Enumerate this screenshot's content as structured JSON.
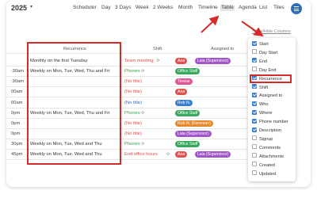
{
  "header": {
    "year": "2025",
    "views": [
      "Scheduler",
      "Day",
      "3 Days",
      "Week",
      "2 Weeks",
      "Month",
      "Timeline",
      "Table",
      "Agenda",
      "List",
      "Tiles"
    ],
    "active_view": "Table",
    "show_hide_columns": "Show/Hide Columns"
  },
  "table": {
    "columns": {
      "recurrence": "Recurrence",
      "shift": "Shift",
      "assigned_to": "Assigned to"
    },
    "rows": [
      {
        "time": "",
        "recurrence": "Monthly on the first Tuesday",
        "shift": "Team meeting",
        "shift_color": "red",
        "assignees": [
          {
            "name": "Ana",
            "color": "red"
          },
          {
            "name": "Laia (Supervisor)",
            "color": "purple"
          }
        ]
      },
      {
        "time": ":30am",
        "recurrence": "Weekly on Mon, Tue, Wed, Thu and Fri",
        "shift": "Phones",
        "shift_color": "green",
        "assignees": [
          {
            "name": "Office Staff",
            "color": "green"
          }
        ]
      },
      {
        "time": ":30am",
        "recurrence": "",
        "shift": "(No title)",
        "shift_color": "red",
        "assignees": [
          {
            "name": "Terese",
            "color": "pink"
          }
        ]
      },
      {
        "time": "00am",
        "recurrence": "",
        "shift": "(No title)",
        "shift_color": "red",
        "assignees": [
          {
            "name": "Ana",
            "color": "red"
          }
        ]
      },
      {
        "time": "00am",
        "recurrence": "",
        "shift": "(No title)",
        "shift_color": "blue",
        "assignees": [
          {
            "name": "Rob N.",
            "color": "blue"
          }
        ]
      },
      {
        "time": "0pm",
        "recurrence": "Weekly on Mon, Tue, Wed, Thu and Fri",
        "shift": "Phones",
        "shift_color": "green",
        "assignees": [
          {
            "name": "Office Staff",
            "color": "green"
          }
        ]
      },
      {
        "time": "0pm",
        "recurrence": "",
        "shift": "(No title)",
        "shift_color": "red",
        "assignees": [
          {
            "name": "Rob N. (Foreman)",
            "color": "orange"
          }
        ]
      },
      {
        "time": "0pm",
        "recurrence": "",
        "shift": "(No title)",
        "shift_color": "red",
        "assignees": [
          {
            "name": "Laia (Supervisor)",
            "color": "purple"
          }
        ]
      },
      {
        "time": "30pm",
        "recurrence": "Weekly on Mon, Tue, Wed and Thu",
        "shift": "Phones",
        "shift_color": "green",
        "assignees": [
          {
            "name": "Office Staff",
            "color": "green"
          }
        ]
      },
      {
        "time": "45pm",
        "recurrence": "Weekly on Mon, Tue, Wed and Thu",
        "shift": "End office hours",
        "shift_color": "red",
        "assignees": [
          {
            "name": "Ana",
            "color": "red"
          },
          {
            "name": "Laia (Supervisor)",
            "color": "purple"
          }
        ]
      }
    ]
  },
  "columns_menu": {
    "options": [
      {
        "label": "Start",
        "checked": true
      },
      {
        "label": "Day Start",
        "checked": false
      },
      {
        "label": "End",
        "checked": true
      },
      {
        "label": "Day End",
        "checked": false
      },
      {
        "label": "Recurrence",
        "checked": true
      },
      {
        "label": "Shift",
        "checked": true
      },
      {
        "label": "Assigned to",
        "checked": true
      },
      {
        "label": "Who",
        "checked": true
      },
      {
        "label": "Where",
        "checked": true
      },
      {
        "label": "Phone number",
        "checked": true
      },
      {
        "label": "Description",
        "checked": true
      },
      {
        "label": "Signup",
        "checked": false
      },
      {
        "label": "Comments",
        "checked": false
      },
      {
        "label": "Attachments",
        "checked": false
      },
      {
        "label": "Created",
        "checked": false
      },
      {
        "label": "Updated",
        "checked": false
      }
    ],
    "highlighted": "Recurrence"
  },
  "colors": {
    "accent": "#2f6fb8",
    "highlight_box": "#d62b2b",
    "red": "#e0524d",
    "purple": "#a055c9",
    "green": "#3aa85c",
    "orange": "#e68a2e",
    "blue": "#3a7ecf",
    "pink": "#e05596"
  },
  "icons": {
    "menu": "hamburger-menu-icon",
    "repeat": "repeat-icon",
    "caret": "chevron-down-icon",
    "eye": "eye-icon"
  }
}
